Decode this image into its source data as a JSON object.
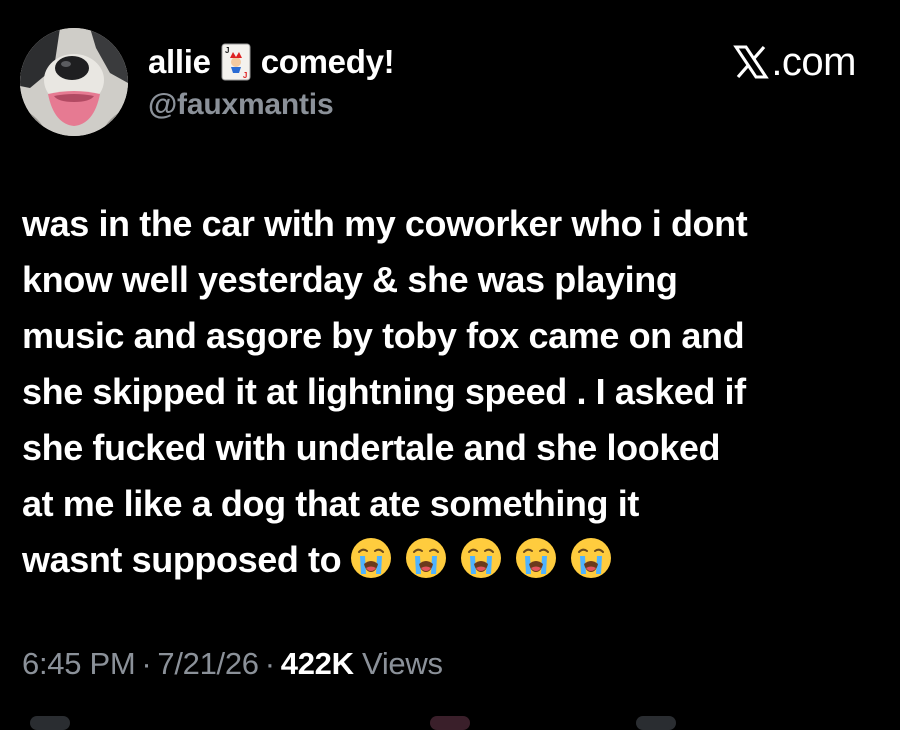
{
  "author": {
    "display_name_first": "allie",
    "display_name_emoji": "joker-card-icon",
    "display_name_second": "comedy!",
    "handle": "@fauxmantis"
  },
  "site": {
    "logo_text": ".com"
  },
  "tweet": {
    "lines": [
      "was in the car with my coworker who i dont",
      "know well yesterday & she was playing",
      "music and asgore by toby fox came on and",
      "she skipped it at lightning speed . I asked if",
      "she fucked with undertale and she looked",
      "at me like a dog that ate something it",
      "wasnt supposed to"
    ],
    "trailing_emoji": [
      "crying-face-icon",
      "crying-face-icon",
      "crying-face-icon",
      "crying-face-icon",
      "crying-face-icon"
    ]
  },
  "meta": {
    "time": "6:45 PM",
    "date": "7/21/26",
    "separator": "·",
    "views_count": "422K",
    "views_label": "Views"
  },
  "colors": {
    "background": "#000000",
    "text": "#ffffff",
    "secondary_text": "#8b9199"
  }
}
